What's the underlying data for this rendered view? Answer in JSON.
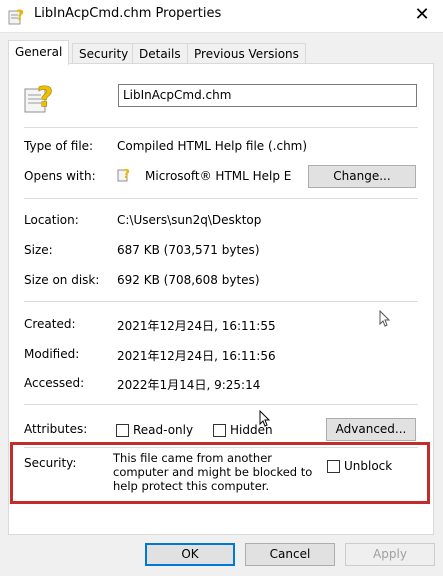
{
  "window": {
    "title": "LibInAcpCmd.chm Properties",
    "close_glyph": "✕"
  },
  "tabs": [
    {
      "label": "General",
      "active": true
    },
    {
      "label": "Security",
      "active": false
    },
    {
      "label": "Details",
      "active": false
    },
    {
      "label": "Previous Versions",
      "active": false
    }
  ],
  "file": {
    "name": "LibInAcpCmd.chm",
    "icon": "help-file-icon"
  },
  "type_of_file": {
    "label": "Type of file:",
    "value": "Compiled HTML Help file (.chm)"
  },
  "opens_with": {
    "label": "Opens with:",
    "value": "Microsoft® HTML Help E",
    "change_label": "Change...",
    "icon": "html-help-icon"
  },
  "location": {
    "label": "Location:",
    "value": "C:\\Users\\sun2q\\Desktop"
  },
  "size": {
    "label": "Size:",
    "value": "687 KB (703,571 bytes)"
  },
  "size_on_disk": {
    "label": "Size on disk:",
    "value": "692 KB (708,608 bytes)"
  },
  "created": {
    "label": "Created:",
    "value": "2021年12月24日, 16:11:55"
  },
  "modified": {
    "label": "Modified:",
    "value": "2021年12月24日, 16:11:56"
  },
  "accessed": {
    "label": "Accessed:",
    "value": "2022年1月14日, 9:25:14"
  },
  "attributes": {
    "label": "Attributes:",
    "readonly_label": "Read-only",
    "readonly_checked": false,
    "hidden_label": "Hidden",
    "hidden_checked": false,
    "advanced_label": "Advanced..."
  },
  "security": {
    "label": "Security:",
    "message": "This file came from another computer and might be blocked to help protect this computer.",
    "unblock_label": "Unblock",
    "unblock_checked": false,
    "highlight_color": "#c42b2b"
  },
  "buttons": {
    "ok": "OK",
    "cancel": "Cancel",
    "apply": "Apply"
  },
  "colors": {
    "accent": "#0078d7"
  }
}
